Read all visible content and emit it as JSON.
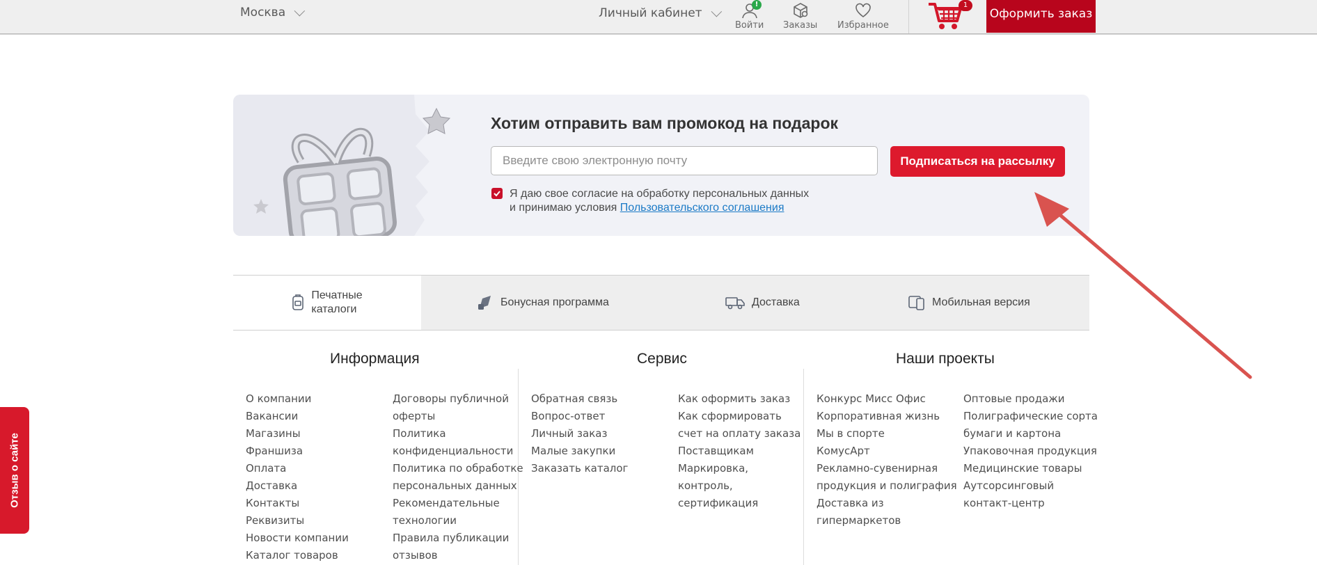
{
  "header": {
    "city": "Москва",
    "cabinet": "Личный кабинет",
    "login_label": "Войти",
    "login_badge": "!",
    "orders_label": "Заказы",
    "favorites_label": "Избранное",
    "cart_count": "1",
    "checkout_label": "Оформить заказ",
    "brand_color": "#b8051c"
  },
  "promo": {
    "title": "Хотим отправить вам промокод на подарок",
    "email_placeholder": "Введите свою электронную почту",
    "subscribe_label": "Подписаться на рассылку",
    "consent_line1": "Я даю свое согласие на обработку персональных данных",
    "consent_line2": "и принимаю условия ",
    "consent_link": "Пользовательского соглашения",
    "consent_checked": true
  },
  "features": [
    {
      "label": "Печатные каталоги",
      "line1": "Печатные",
      "line2": "каталоги",
      "icon": "catalog-icon"
    },
    {
      "label": "Бонусная программа",
      "icon": "bonus-icon"
    },
    {
      "label": "Доставка",
      "icon": "truck-icon"
    },
    {
      "label": "Мобильная версия",
      "icon": "mobile-icon"
    }
  ],
  "footer": {
    "info": {
      "title": "Информация",
      "col1": [
        "О компании",
        "Вакансии",
        "Магазины",
        "Франшиза",
        "Оплата",
        "Доставка",
        "Контакты",
        "Реквизиты",
        "Новости компании",
        "Каталог товаров"
      ],
      "col2": [
        "Договоры публичной",
        "оферты",
        "Политика",
        "конфиденциальности",
        "Политика по обработке",
        "персональных данных",
        "Рекомендательные",
        "технологии",
        "Правила публикации",
        "отзывов"
      ]
    },
    "service": {
      "title": "Сервис",
      "col1": [
        "Обратная связь",
        "Вопрос-ответ",
        "Личный заказ",
        "Малые закупки",
        "Заказать каталог"
      ],
      "col2": [
        "Как оформить заказ",
        "Как сформировать",
        "счет на оплату заказа",
        "Поставщикам",
        "Маркировка,",
        "контроль,",
        "сертификация"
      ]
    },
    "projects": {
      "title": "Наши проекты",
      "col1": [
        "Конкурс Мисс Офис",
        "Корпоративная жизнь",
        "Мы в спорте",
        "КомусАрт",
        "Рекламно-сувенирная",
        "продукция и полиграфия",
        "Доставка из",
        "гипермаркетов"
      ],
      "col2": [
        "Оптовые продажи",
        "Полиграфические сорта",
        "бумаги и картона",
        "Упаковочная продукция",
        "Медицинские товары",
        "Аутсорсинговый",
        "контакт-центр"
      ]
    }
  },
  "side_tab": "Отзыв о сайте",
  "annotation_color": "#d9534f"
}
